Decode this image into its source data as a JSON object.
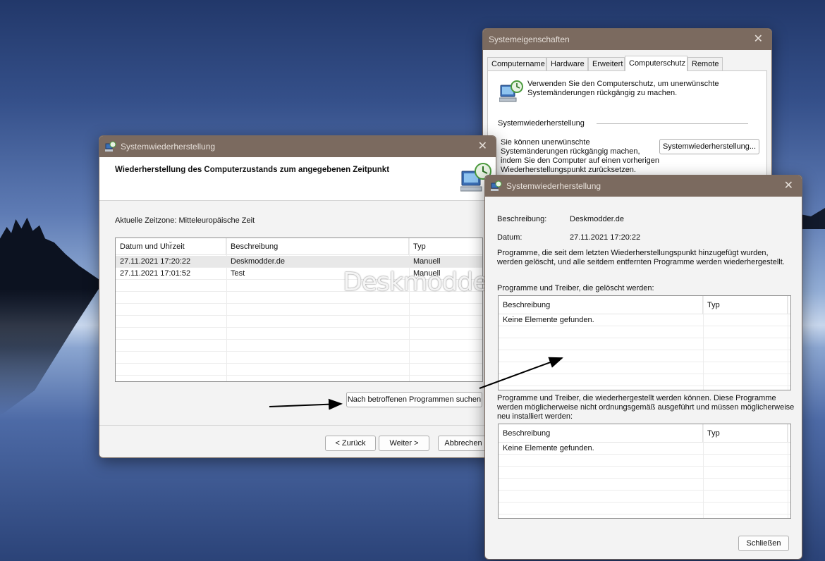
{
  "sysprops": {
    "title": "Systemeigenschaften",
    "tabs": [
      "Computername",
      "Hardware",
      "Erweitert",
      "Computerschutz",
      "Remote"
    ],
    "intro_line1": "Verwenden Sie den Computerschutz, um unerwünschte",
    "intro_line2": "Systemänderungen rückgängig zu machen.",
    "section_title": "Systemwiederherstellung",
    "desc_line1": "Sie können unerwünschte",
    "desc_line2": "Systemänderungen rückgängig machen,",
    "desc_line3": "indem Sie den Computer auf einen vorherigen",
    "desc_line4": "Wiederherstellungspunkt zurücksetzen.",
    "restore_button": "Systemwiederherstellung..."
  },
  "restore": {
    "title": "Systemwiederherstellung",
    "heading": "Wiederherstellung des Computerzustands zum angegebenen Zeitpunkt",
    "timezone": "Aktuelle Zeitzone: Mitteleuropäische Zeit",
    "columns": [
      "Datum und Uhrzeit",
      "Beschreibung",
      "Typ"
    ],
    "rows": [
      {
        "date": "27.11.2021 17:20:22",
        "desc": "Deskmodder.de",
        "type": "Manuell"
      },
      {
        "date": "27.11.2021 17:01:52",
        "desc": "Test",
        "type": "Manuell"
      }
    ],
    "scan_button": "Nach betroffenen Programmen suchen",
    "back_button": "< Zurück",
    "next_button": "Weiter >",
    "cancel_button": "Abbrechen",
    "watermark": "Deskmodder.de"
  },
  "affected": {
    "title": "Systemwiederherstellung",
    "desc_label": "Beschreibung:",
    "desc_value": "Deskmodder.de",
    "date_label": "Datum:",
    "date_value": "27.11.2021 17:20:22",
    "info_line1": "Programme, die seit dem letzten Wiederherstellungspunkt hinzugefügt wurden,",
    "info_line2": "werden gelöscht, und alle seitdem entfernten Programme werden wiederhergestellt.",
    "deleted_label": "Programme und Treiber, die gelöscht werden:",
    "restored_line1": "Programme und Treiber, die wiederhergestellt werden können. Diese Programme",
    "restored_line2": "werden möglicherweise nicht ordnungsgemäß ausgeführt und müssen möglicherweise",
    "restored_line3": "neu installiert werden:",
    "col_desc": "Beschreibung",
    "col_type": "Typ",
    "empty_text": "Keine Elemente gefunden.",
    "close_button": "Schließen"
  }
}
